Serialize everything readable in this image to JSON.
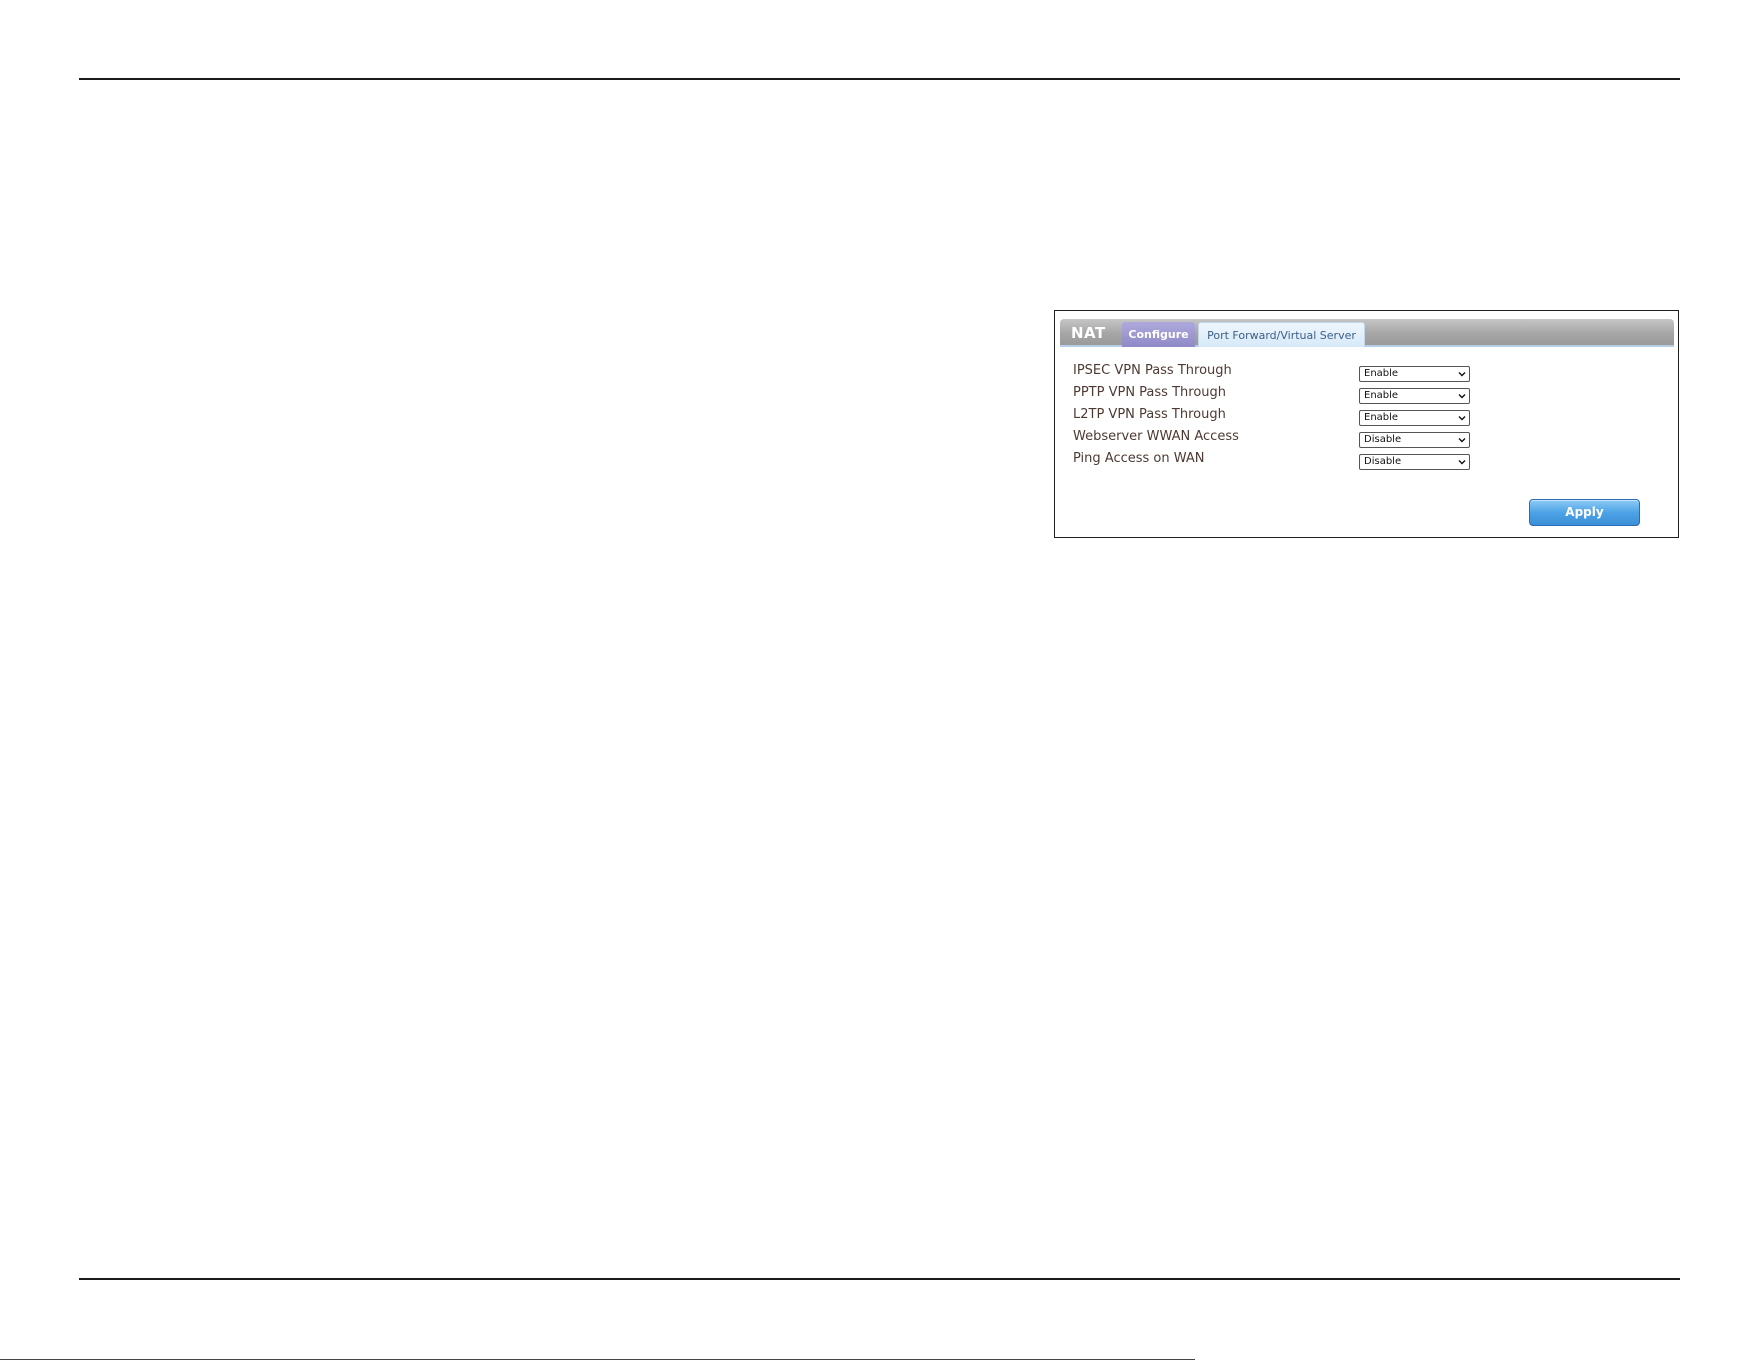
{
  "panel": {
    "title": "NAT",
    "tabs": [
      {
        "label": "Configure",
        "active": true
      },
      {
        "label": "Port Forward/Virtual Server",
        "active": false
      }
    ],
    "rows": [
      {
        "label": "IPSEC VPN Pass Through",
        "value": "Enable",
        "options": [
          "Enable",
          "Disable"
        ]
      },
      {
        "label": "PPTP VPN Pass Through",
        "value": "Enable",
        "options": [
          "Enable",
          "Disable"
        ]
      },
      {
        "label": "L2TP VPN Pass Through",
        "value": "Enable",
        "options": [
          "Enable",
          "Disable"
        ]
      },
      {
        "label": "Webserver WWAN Access",
        "value": "Disable",
        "options": [
          "Enable",
          "Disable"
        ]
      },
      {
        "label": "Ping Access on WAN",
        "value": "Disable",
        "options": [
          "Enable",
          "Disable"
        ]
      }
    ],
    "apply_label": "Apply"
  },
  "colors": {
    "active_tab": "#9a94cf",
    "inactive_tab": "#e3f0fb",
    "apply_button": "#4ea3e6",
    "label_text": "#4d3a33"
  },
  "icons": {
    "select_chevron": "chevron-down-icon"
  }
}
